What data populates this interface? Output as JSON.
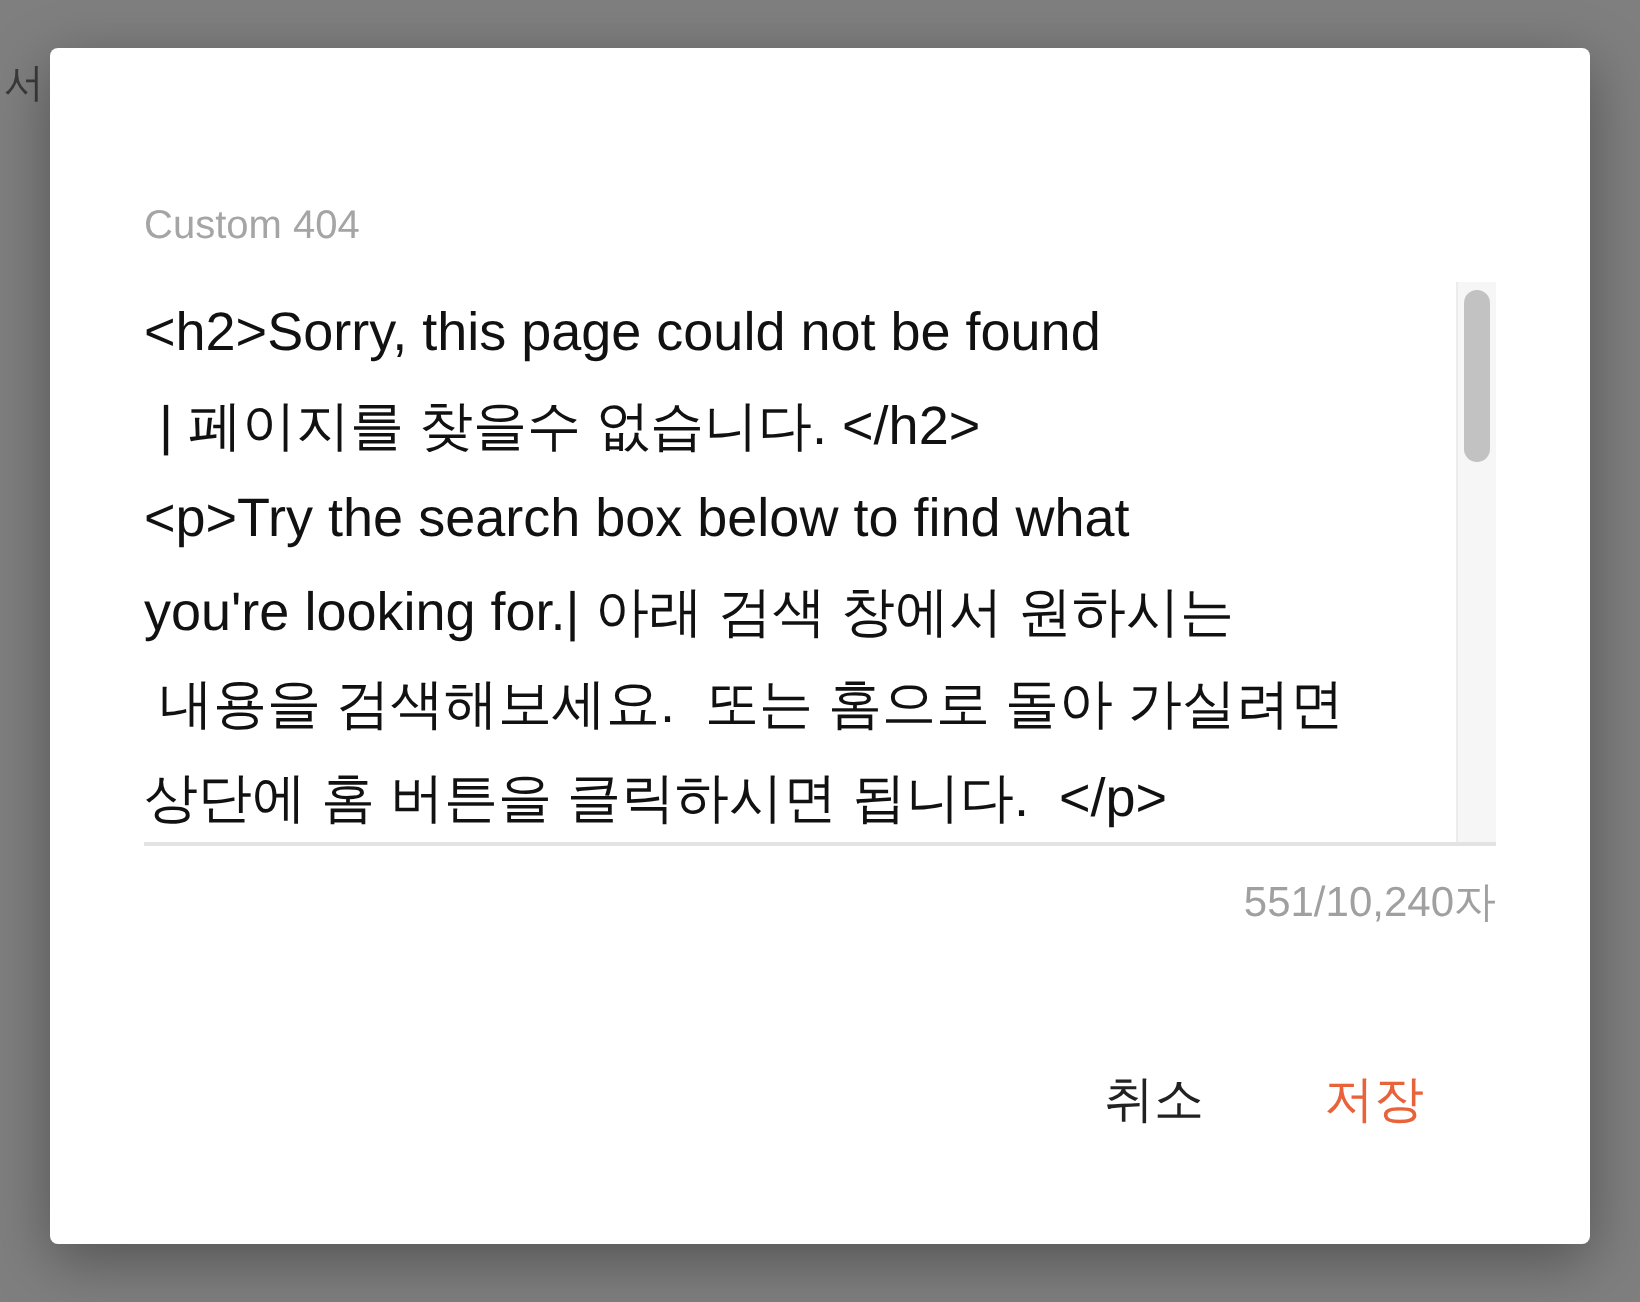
{
  "background": {
    "fragment": "서"
  },
  "dialog": {
    "label": "Custom 404",
    "field": {
      "value": "<h2>Sorry, this page could not be found\n | 페이지를 찾을수 없습니다. </h2>\n<p>Try the search box below to find what\nyou're looking for.| 아래 검색 창에서 원하시는\n 내용을 검색해보세요.  또는 홈으로 돌아 가실려면\n상단에 홈 버튼을 클릭하시면 됩니다.  </p>"
    },
    "counter": "551/10,240자",
    "buttons": [
      {
        "label": "취소",
        "kind": "secondary"
      },
      {
        "label": "저장",
        "kind": "primary"
      }
    ]
  }
}
